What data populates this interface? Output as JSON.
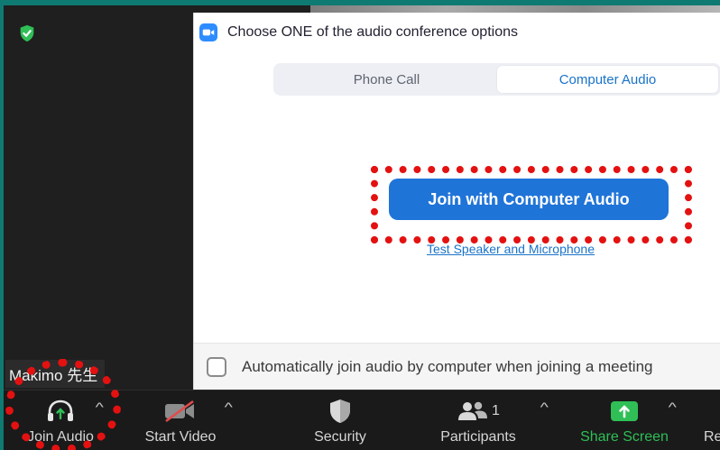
{
  "dialog": {
    "title": "Choose ONE of the audio conference options",
    "tabs": [
      {
        "label": "Phone Call",
        "active": false
      },
      {
        "label": "Computer Audio",
        "active": true
      }
    ],
    "join_button": "Join with Computer Audio",
    "test_link": "Test Speaker and Microphone",
    "auto_join_label": "Automatically join audio by computer when joining a meeting",
    "auto_join_checked": false
  },
  "participant_name": "Makimo 先生",
  "toolbar": {
    "join_audio": "Join Audio",
    "start_video": "Start Video",
    "security": "Security",
    "participants": "Participants",
    "participant_count": "1",
    "share_screen": "Share Screen",
    "record_partial": "Re"
  },
  "colors": {
    "accent": "#1f74d8",
    "highlight": "#e41111",
    "share_green": "#2fbf56",
    "toolbar_bg": "#1a1a1a"
  },
  "icons": {
    "encryption": "shield-check-icon",
    "zoom_logo": "zoom-camera-icon",
    "join_audio": "headphones-icon",
    "start_video": "video-off-icon",
    "security": "shield-icon",
    "participants": "people-icon",
    "share_screen": "share-arrow-icon"
  }
}
